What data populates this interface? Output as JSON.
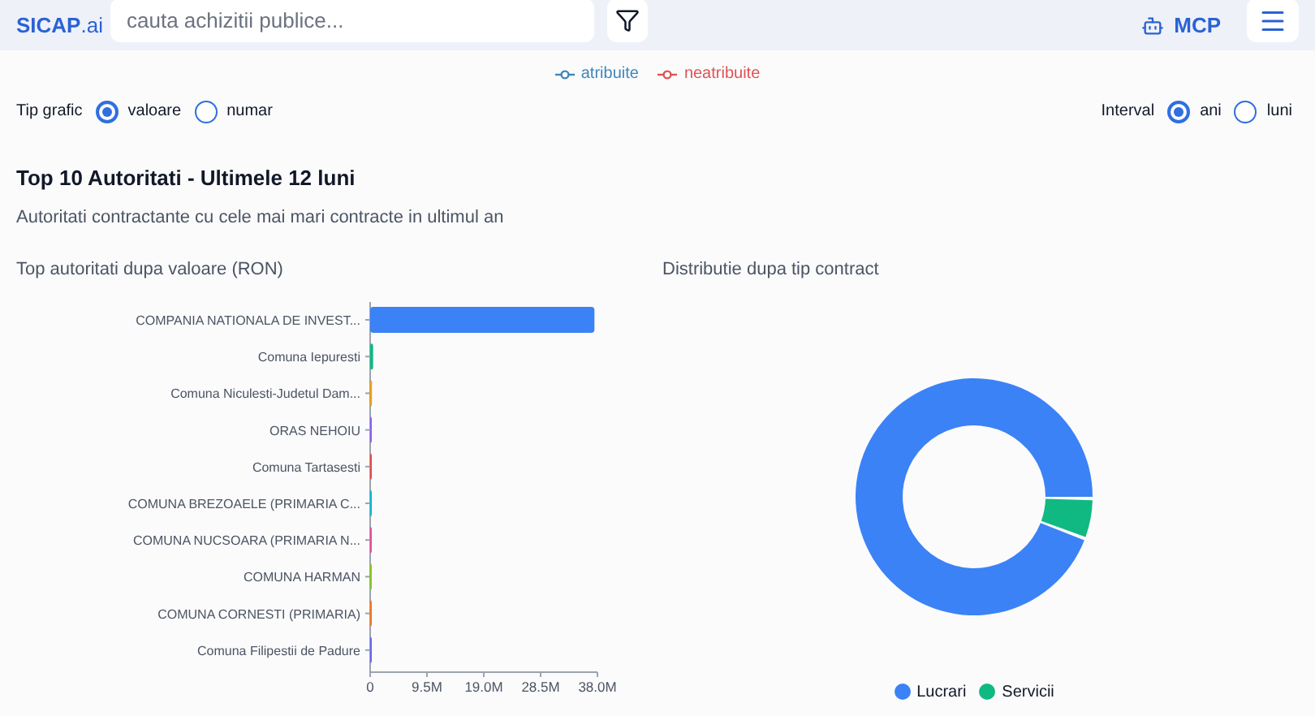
{
  "header": {
    "logo": {
      "brand": "SICAP",
      "suffix": ".ai"
    },
    "search": {
      "placeholder": "cauta achizitii publice..."
    },
    "mcp_button": "MCP"
  },
  "legend": [
    {
      "label": "atribuite",
      "color": "#3f86b8"
    },
    {
      "label": "neatribuite",
      "color": "#e05252"
    }
  ],
  "chart_type": {
    "label": "Tip grafic",
    "options": [
      {
        "label": "valoare",
        "selected": true
      },
      {
        "label": "numar",
        "selected": false
      }
    ]
  },
  "interval": {
    "label": "Interval",
    "options": [
      {
        "label": "ani",
        "selected": true
      },
      {
        "label": "luni",
        "selected": false
      }
    ]
  },
  "section": {
    "title": "Top 10 Autoritati - Ultimele 12 luni",
    "subtitle": "Autoritati contractante cu cele mai mari contracte in ultimul an"
  },
  "bar_panel": {
    "title": "Top autoritati dupa valoare (RON)",
    "chart_data": {
      "type": "bar",
      "orientation": "horizontal",
      "categories": [
        "COMPANIA NATIONALA DE INVEST...",
        "Comuna Iepuresti",
        "Comuna Niculesti-Judetul Dam...",
        "ORAS NEHOIU",
        "Comuna Tartasesti",
        "COMUNA BREZOAELE (PRIMARIA C...",
        "COMUNA NUCSOARA (PRIMARIA N...",
        "COMUNA HARMAN",
        "COMUNA CORNESTI (PRIMARIA)",
        "Comuna Filipestii de Padure"
      ],
      "series": [
        {
          "values": [
            37500000,
            500000,
            300000,
            200000,
            200000,
            200000,
            200000,
            100000,
            100000,
            100000
          ]
        }
      ],
      "xlim": [
        0,
        38000000
      ],
      "xticks": [
        {
          "value": 0,
          "label": "0"
        },
        {
          "value": 9500000,
          "label": "9.5M"
        },
        {
          "value": 19000000,
          "label": "19.0M"
        },
        {
          "value": 28500000,
          "label": "28.5M"
        },
        {
          "value": 38000000,
          "label": "38.0M"
        }
      ]
    }
  },
  "donut_panel": {
    "title": "Distributie dupa tip contract",
    "legend": [
      {
        "label": "Lucrari",
        "color": "#3b82f6"
      },
      {
        "label": "Servicii",
        "color": "#10b981"
      }
    ]
  }
}
